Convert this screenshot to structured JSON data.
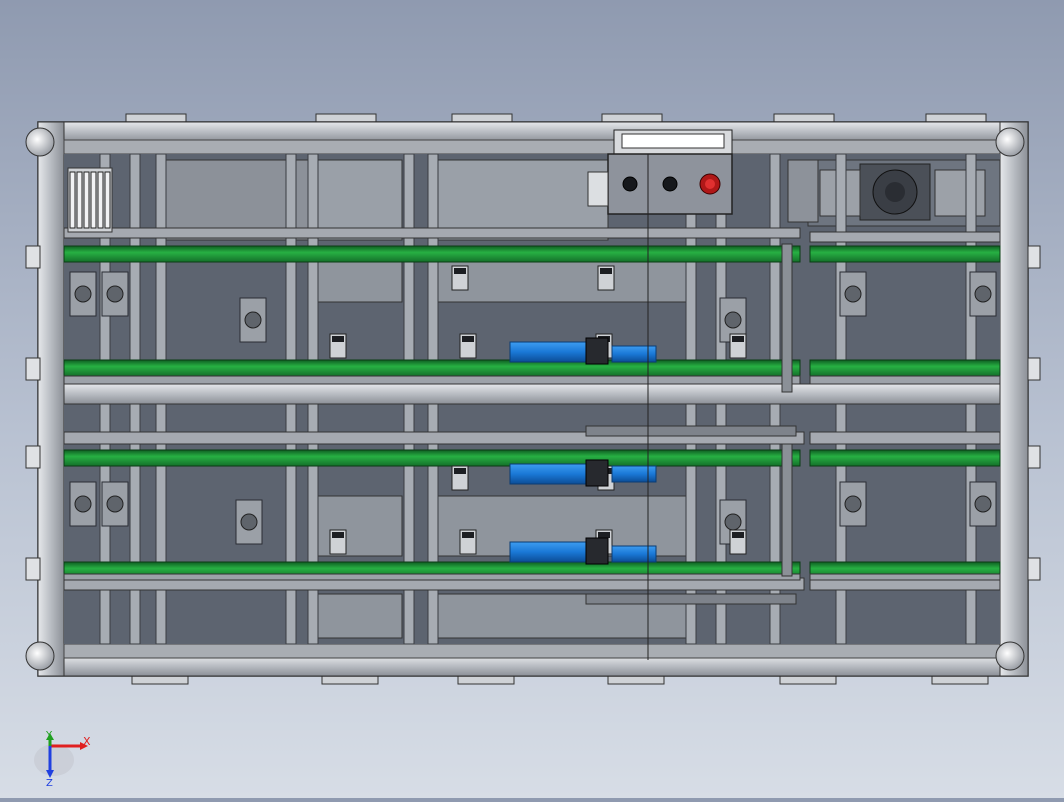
{
  "viewport": {
    "background_top": "#8f9ab0",
    "background_bottom": "#d7dde6"
  },
  "model": {
    "frame_color": "#c9ccd1",
    "frame_edge": "#3a3d42",
    "interior_color": "#5d6470",
    "belt_color": "#1f9a3a",
    "motor_color": "#1a78d6",
    "panel_color": "#8e939c",
    "buttons": [
      "black",
      "black",
      "red"
    ]
  },
  "triad": {
    "x_label": "X",
    "y_label": "Y",
    "z_label": "Z",
    "x_color": "#e02020",
    "y_color": "#20a020",
    "z_color": "#2040e0"
  }
}
